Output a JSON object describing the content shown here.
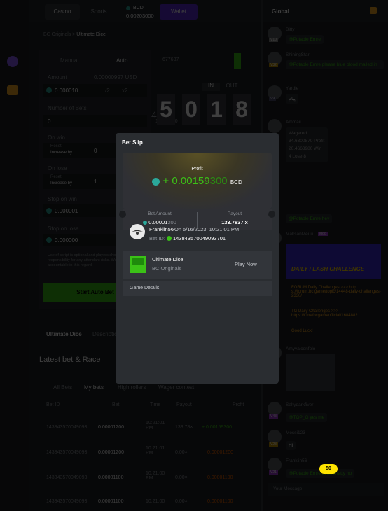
{
  "topbar": {
    "casino": "Casino",
    "sports": "Sports",
    "balance_currency": "BCD",
    "balance_value": "0.00203000",
    "wallet": "Wallet"
  },
  "breadcrumb": {
    "root": "BC Originals",
    "sep": ">",
    "current": "Ultimate Dice"
  },
  "bet_panel": {
    "mode_manual": "Manual",
    "mode_auto": "Auto",
    "amount_label": "Amount",
    "amount_usd": "0.00000997 USD",
    "amount_value": "0.000010",
    "half": "/2",
    "double": "x2",
    "number_of_bets_label": "Number of Bets",
    "number_of_bets": "0",
    "on_win_label": "On win",
    "on_win_reset": "Reset",
    "on_win_increase": "Increase by",
    "on_win_value": "0",
    "on_lose_label": "On lose",
    "on_lose_reset": "Reset",
    "on_lose_increase": "Increase by",
    "on_lose_value": "1",
    "stop_win_label": "Stop on win",
    "stop_win_value": "0.000001",
    "stop_lose_label": "Stop on lose",
    "stop_lose_value": "0.000000",
    "start_button": "Start Auto Bet",
    "notice": "Use of script is optional and players should take full responsibility for any attendant risks. We will not be held accountable in this regard."
  },
  "dice": {
    "history": "677637",
    "in": "IN",
    "out": "OUT",
    "range_a": "4963",
    "range_b": "10",
    "range_c": "100",
    "digits": [
      "5",
      "0",
      "1",
      "8"
    ]
  },
  "tabs": {
    "ultimate_dice": "Ultimate Dice",
    "description": "Description"
  },
  "latest": {
    "title": "Latest bet & Race",
    "filters": [
      "All Bets",
      "My bets",
      "High rollers",
      "Wager contest"
    ],
    "columns": [
      "Bet ID",
      "Bet",
      "Time",
      "Payout",
      "Profit"
    ],
    "rows": [
      {
        "id": "143843570049093",
        "bet": "0.00001200",
        "time": "10:21:01 PM",
        "payout": "133.78×",
        "profit": "+ 0.00159300"
      },
      {
        "id": "143843570049093",
        "bet": "0.00001200",
        "time": "10:21:01 PM",
        "payout": "0.00×",
        "profit": "0.00001200"
      },
      {
        "id": "143843570049093",
        "bet": "0.00001100",
        "time": "10:21:00 PM",
        "payout": "0.00×",
        "profit": "0.00001100"
      },
      {
        "id": "143843570049093",
        "bet": "0.00001100",
        "time": "10:21:00",
        "payout": "0.00×",
        "profit": "0.00001100"
      }
    ]
  },
  "modal": {
    "title": "Bet Slip",
    "profit_label": "Profit",
    "profit_prefix": "+",
    "profit_main": "0.00159",
    "profit_tail": "300",
    "profit_currency": "BCD",
    "bet_amount_label": "Bet Amount",
    "bet_amount_main": "0.00001",
    "bet_amount_tail": "200",
    "payout_label": "Payout",
    "payout_value": "133.7837 x",
    "username": "Franklin56",
    "date_text": "On 5/16/2023, 10:21:01 PM",
    "bet_id_label": "Bet ID:",
    "bet_id": "143843570049093701",
    "game_name": "Ultimate Dice",
    "game_provider": "BC Originals",
    "play_now": "Play Now",
    "game_details": "Game Details"
  },
  "chat": {
    "tab": "Global",
    "messages": [
      {
        "user": "Bitty",
        "level": "V10",
        "text": "@Potable Emre"
      },
      {
        "user": "ShiningStar",
        "level": "V32",
        "text": "@Potable Emre please blue blood mailed in"
      },
      {
        "user": "Yardie",
        "level": "V9",
        "text": "پیام"
      },
      {
        "user": "Ammaii",
        "level": "",
        "text": "Wagered 34.6300870 Profit 20.4663980 Win 4 Lose 8"
      },
      {
        "user": "",
        "level": "",
        "text": "@Potable Emre hey"
      },
      {
        "user": "MaksanMeuu",
        "level": "Mod",
        "text": "DAILY FLASH CHALLENGE"
      },
      {
        "user": "",
        "level": "",
        "text": "FORUM Daily Challenges >>> http s://forum.bc.game/topic/14448-daily-challenges-2330/"
      },
      {
        "user": "",
        "level": "",
        "text": "TG Daily Challenges >>> https://t.me/bcgameofficial/1684882"
      },
      {
        "user": "",
        "level": "",
        "text": "Good Luck!"
      },
      {
        "user": "Amyvalconfolo",
        "level": "",
        "text": ""
      },
      {
        "user": "Saltydarkfiver",
        "level": "V43",
        "text": "@TOP_G yes me"
      },
      {
        "user": "Messi123",
        "level": "V28",
        "text": "Hi"
      },
      {
        "user": "Franklin56",
        "level": "V21",
        "text": "@Potable Emre at ka khatty ho"
      }
    ],
    "badge": "50",
    "input_placeholder": "Your Message"
  }
}
